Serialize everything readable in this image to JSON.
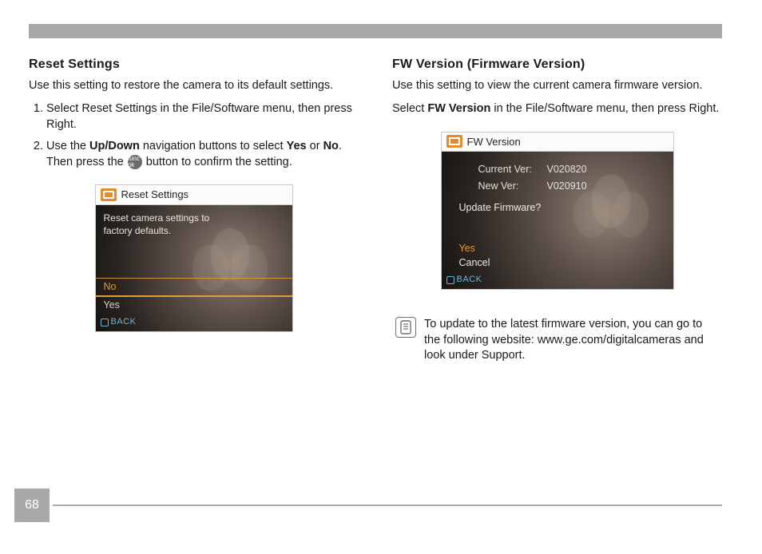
{
  "page_number": "68",
  "left": {
    "title": "Reset Settings",
    "desc": "Use this setting to restore the camera to its default settings.",
    "step1_a": "Select Reset Settings in the File/Software menu, then press Right.",
    "step2_a": "Use the ",
    "step2_updown": "Up/Down",
    "step2_b": " navigation buttons to select ",
    "step2_yes": "Yes",
    "step2_c": " or ",
    "step2_no": "No",
    "step2_d": ". Then press the ",
    "step2_func": "func ok",
    "step2_e": " button to confirm the setting.",
    "cam": {
      "title": "Reset Settings",
      "body_l1": "Reset camera settings to",
      "body_l2": "factory defaults.",
      "opt_no": "No",
      "opt_yes": "Yes",
      "back": "BACK"
    }
  },
  "right": {
    "title": "FW Version (Firmware Version)",
    "desc": "Use this setting to view the current camera firmware version.",
    "instr_a": "Select ",
    "instr_b": "FW Version",
    "instr_c": " in the File/Software menu, then press Right.",
    "cam": {
      "title": "FW Version",
      "curr_lbl": "Current Ver:",
      "curr_val": "V020820",
      "new_lbl": "New Ver:",
      "new_val": "V020910",
      "question": "Update Firmware?",
      "opt_yes": "Yes",
      "opt_cancel": "Cancel",
      "back": "BACK"
    },
    "note": "To update to the latest firmware version, you can go to the following website: www.ge.com/digitalcameras and look under Support."
  }
}
